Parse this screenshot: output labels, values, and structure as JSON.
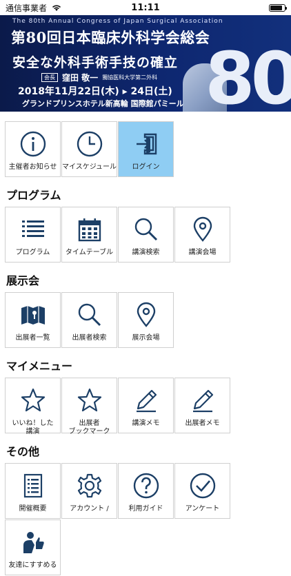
{
  "status": {
    "carrier": "通信事業者",
    "time": "11:11"
  },
  "banner": {
    "en_title": "The 80th Annual Congress of Japan Surgical Association",
    "title": "第80回日本臨床外科学会総会",
    "subtitle": "安全な外科手術手技の確立",
    "chair_tag": "会長",
    "chair_name": "窪田 敬一",
    "chair_affiliation": "獨協医科大学第二外科",
    "date": "2018年11月22日(木) ▸ 24日(土)",
    "venue": "グランドプリンスホテル新高輪 国際館パミール",
    "big_number": "80"
  },
  "top_menu": [
    {
      "label": "主催者お知らせ",
      "icon": "info-icon"
    },
    {
      "label": "マイスケジュール",
      "icon": "clock-icon"
    },
    {
      "label": "ログイン",
      "icon": "login-icon"
    }
  ],
  "sections": {
    "program": {
      "title": "プログラム",
      "items": [
        {
          "label": "プログラム",
          "icon": "list-icon"
        },
        {
          "label": "タイムテーブル",
          "icon": "calendar-icon"
        },
        {
          "label": "講演検索",
          "icon": "search-icon"
        },
        {
          "label": "講演会場",
          "icon": "location-pin-icon"
        }
      ]
    },
    "exhibit": {
      "title": "展示会",
      "items": [
        {
          "label": "出展者一覧",
          "icon": "map-icon"
        },
        {
          "label": "出展者検索",
          "icon": "search-icon"
        },
        {
          "label": "展示会場",
          "icon": "location-pin-icon"
        }
      ]
    },
    "mymenu": {
      "title": "マイメニュー",
      "items": [
        {
          "label": "いいね！した\n講演",
          "icon": "star-icon"
        },
        {
          "label": "出展者\nブックマーク",
          "icon": "star-icon"
        },
        {
          "label": "講演メモ",
          "icon": "pencil-icon"
        },
        {
          "label": "出展者メモ",
          "icon": "pencil-icon"
        }
      ]
    },
    "other": {
      "title": "その他",
      "items": [
        {
          "label": "開催概要",
          "icon": "document-icon"
        },
        {
          "label": "アカウント /",
          "icon": "gear-icon"
        },
        {
          "label": "利用ガイド",
          "icon": "question-icon"
        },
        {
          "label": "アンケート",
          "icon": "checkmark-icon"
        },
        {
          "label": "友達にすすめる",
          "icon": "thumbs-up-icon"
        }
      ]
    }
  },
  "colors": {
    "icon": "#1c3f66",
    "active_tile": "#8fcdf3",
    "banner": "#0e2770"
  }
}
